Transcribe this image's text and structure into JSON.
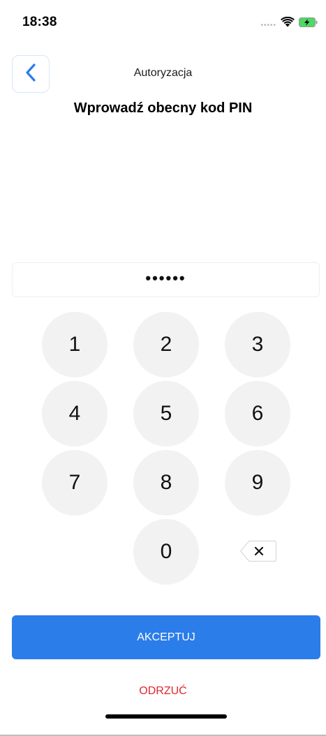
{
  "status_bar": {
    "time": "18:38",
    "signal_icon": "signal-dots-icon",
    "wifi_icon": "wifi-icon",
    "battery_icon": "battery-charging-icon",
    "battery_color": "#4cd964"
  },
  "header": {
    "back_icon": "chevron-left-icon",
    "title": "Autoryzacja"
  },
  "headline": "Wprowadź obecny kod PIN",
  "pin_field": {
    "masked_value": "••••••"
  },
  "keypad": {
    "keys": [
      "1",
      "2",
      "3",
      "4",
      "5",
      "6",
      "7",
      "8",
      "9",
      "0"
    ],
    "backspace_icon": "backspace-icon"
  },
  "actions": {
    "accept_label": "AKCEPTUJ",
    "reject_label": "ODRZUĆ"
  },
  "colors": {
    "accent": "#2b7de9",
    "danger": "#e3262e",
    "key_background": "#f2f2f2"
  }
}
